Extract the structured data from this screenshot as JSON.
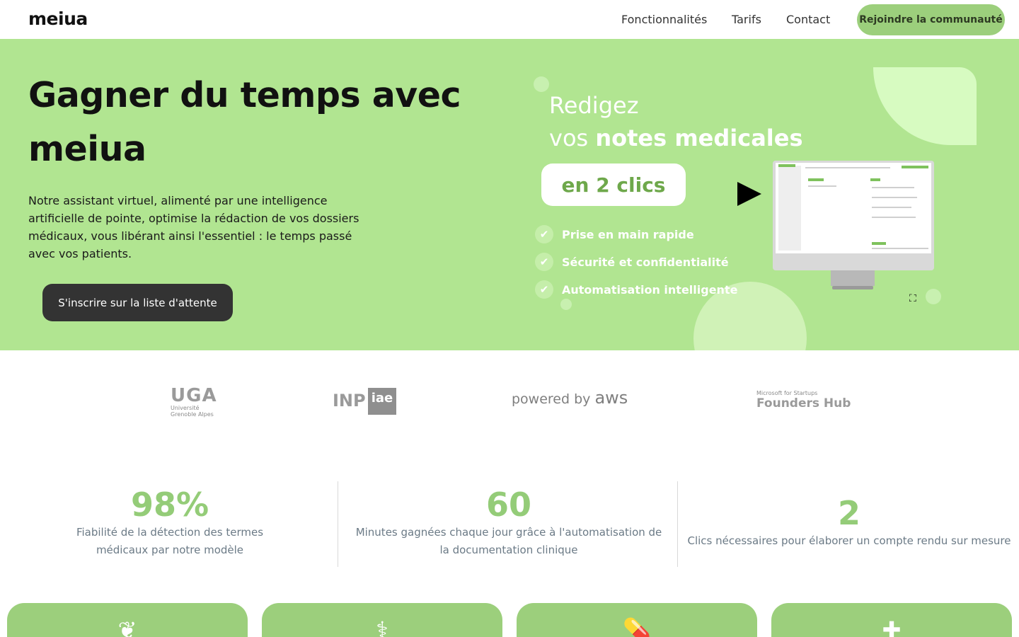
{
  "header": {
    "logo": "meiua",
    "nav": [
      "Fonctionnalités",
      "Tarifs",
      "Contact"
    ],
    "join_label": "Rejoindre la communauté"
  },
  "hero": {
    "title": "Gagner du temps avec meiua",
    "description": "Notre assistant virtuel, alimenté par une intelligence artificielle de pointe, optimise la rédaction de vos dossiers médicaux, vous libérant ainsi l'essentiel : le temps passé avec vos patients.",
    "cta_label": "S'inscrire sur la liste d'attente"
  },
  "promo": {
    "line1": "Redigez",
    "line2_prefix": "vos ",
    "line2_bold": "notes medicales",
    "pill": "en 2 clics",
    "features": [
      "Prise en main rapide",
      "Sécurité et confidentialité",
      "Automatisation intelligente"
    ],
    "icons": [
      "check-icon",
      "play-icon",
      "fullscreen-icon"
    ]
  },
  "partners": {
    "uga": {
      "abbr": "UGA",
      "line1": "Université",
      "line2": "Grenoble Alpes"
    },
    "inp": {
      "left": "INP",
      "right": "iae"
    },
    "aws": {
      "prefix": "powered by ",
      "brand": "aws"
    },
    "msft": {
      "small": "Microsoft for Startups",
      "big": "Founders Hub"
    }
  },
  "stats": [
    {
      "value": "98%",
      "label": "Fiabilité de la détection des termes médicaux par notre modèle"
    },
    {
      "value": "60",
      "label": "Minutes gagnées chaque jour grâce à l'automatisation de la documentation clinique"
    },
    {
      "value": "2",
      "label": "Clics nécessaires pour élaborer un compte rendu sur mesure"
    }
  ],
  "cards": [
    {
      "icon": "brain-icon"
    },
    {
      "icon": "stethoscope-icon"
    },
    {
      "icon": "pills-icon"
    },
    {
      "icon": "user-plus-icon"
    }
  ],
  "colors": {
    "hero_bg": "#b1e591",
    "accent": "#9ccf7c",
    "stat_number": "#94cc78",
    "cta_bg": "#333333"
  }
}
